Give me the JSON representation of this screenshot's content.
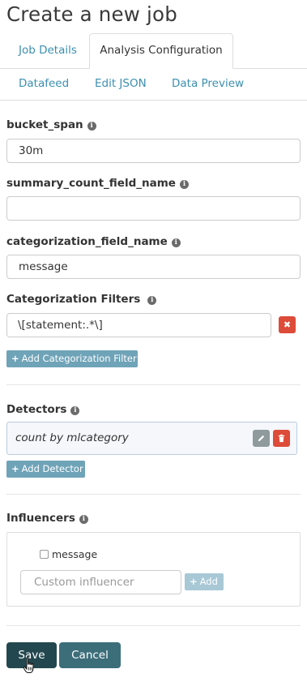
{
  "page": {
    "title": "Create a new job"
  },
  "tabs": {
    "job_details": "Job Details",
    "analysis_configuration": "Analysis Configuration",
    "datafeed": "Datafeed",
    "edit_json": "Edit JSON",
    "data_preview": "Data Preview",
    "active": "analysis_configuration"
  },
  "fields": {
    "bucket_span": {
      "label": "bucket_span",
      "value": "30m"
    },
    "summary_count_field_name": {
      "label": "summary_count_field_name",
      "value": ""
    },
    "categorization_field_name": {
      "label": "categorization_field_name",
      "value": "message"
    }
  },
  "categorization_filters": {
    "label": "Categorization Filters",
    "filters": [
      "\\[statement:.*\\]"
    ],
    "add_label": "Add Categorization Filter"
  },
  "detectors": {
    "label": "Detectors",
    "items": [
      "count by mlcategory"
    ],
    "add_label": "Add Detector"
  },
  "influencers": {
    "label": "Influencers",
    "options": [
      {
        "label": "message",
        "checked": false
      }
    ],
    "custom_placeholder": "Custom influencer",
    "add_label": "Add"
  },
  "actions": {
    "save": "Save",
    "cancel": "Cancel"
  },
  "icons": {
    "info": "info-circle-icon",
    "remove": "times-icon",
    "edit": "pencil-icon",
    "delete": "trash-icon",
    "add": "plus-icon",
    "cursor": "hand-pointer-icon"
  },
  "colors": {
    "link": "#3c8fb0",
    "add_button": "#6fa3b8",
    "danger": "#dd4b39",
    "save": "#23474f",
    "cancel": "#3c6e7a"
  }
}
